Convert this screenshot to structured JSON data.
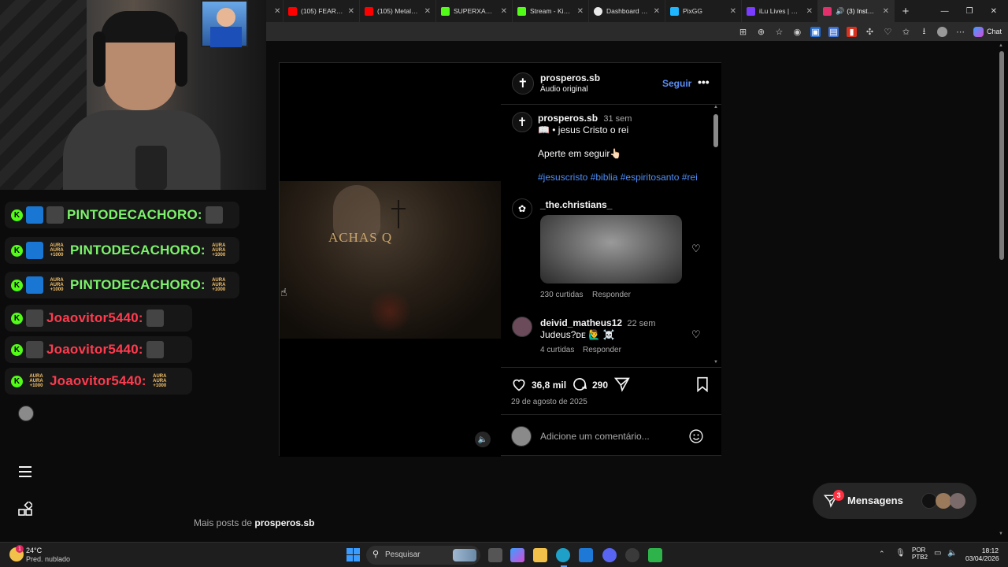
{
  "tabs": [
    {
      "label": "(105) FEAR THE",
      "color": "#ff0000"
    },
    {
      "label": "(105) Metal Instr",
      "color": "#ff0000"
    },
    {
      "label": "SUPERXANDAO",
      "color": "#53fc18"
    },
    {
      "label": "Stream - Kick Da",
      "color": "#53fc18"
    },
    {
      "label": "Dashboard - Live",
      "color": "#e8e8e8"
    },
    {
      "label": "PixGG",
      "color": "#1fb6ff"
    },
    {
      "label": "iLu Lives | React",
      "color": "#7a3cff"
    },
    {
      "label": "(3) Instagram",
      "color": "#e1306c"
    }
  ],
  "toolbar": {
    "chat_label": "Chat"
  },
  "chat_overlay": {
    "rows": [
      {
        "user": "PINTODECACHORO:",
        "color": "green"
      },
      {
        "user": "PINTODECACHORO:",
        "color": "green"
      },
      {
        "user": "PINTODECACHORO:",
        "color": "green"
      },
      {
        "user": "Joaovitor5440:",
        "color": "red"
      },
      {
        "user": "Joaovitor5440:",
        "color": "red"
      },
      {
        "user": "Joaovitor5440:",
        "color": "red"
      }
    ],
    "aura_badge": {
      "line1": "AURA",
      "line2": "AURA",
      "line3": "+1000"
    }
  },
  "post": {
    "video_overlay_text": "ACHAS Q",
    "header": {
      "username": "prosperos.sb",
      "subtitle": "Áudio original",
      "follow_label": "Seguir"
    },
    "caption": {
      "username": "prosperos.sb",
      "age": "31 sem",
      "line1": "📖 • jesus Cristo o rei",
      "line2": "Aperte em seguir👆🏻",
      "hashtags": "#jesuscristo #biblia #espiritosanto #rei"
    },
    "comments": [
      {
        "username": "_the.christians_",
        "age": "",
        "text": "",
        "likes": "230 curtidas",
        "reply": "Responder"
      },
      {
        "username": "deivid_matheus12",
        "age": "22 sem",
        "text": "Judeus?ᴅᴇ 🙋‍♂️ ☠️",
        "likes": "4 curtidas",
        "reply": "Responder"
      }
    ],
    "actions": {
      "likes": "36,8 mil",
      "comments": "290"
    },
    "date": "29 de agosto de 2025",
    "comment_placeholder": "Adicione um comentário..."
  },
  "more_posts": {
    "prefix": "Mais posts de ",
    "username": "prosperos.sb"
  },
  "messages": {
    "label": "Mensagens",
    "badge": "3"
  },
  "taskbar": {
    "weather_temp": "24°C",
    "weather_desc": "Pred. nublado",
    "weather_badge": "1",
    "search_label": "Pesquisar",
    "lang1": "POR",
    "lang2": "PTB2",
    "time": "18:12",
    "date": "03/04/2026"
  }
}
